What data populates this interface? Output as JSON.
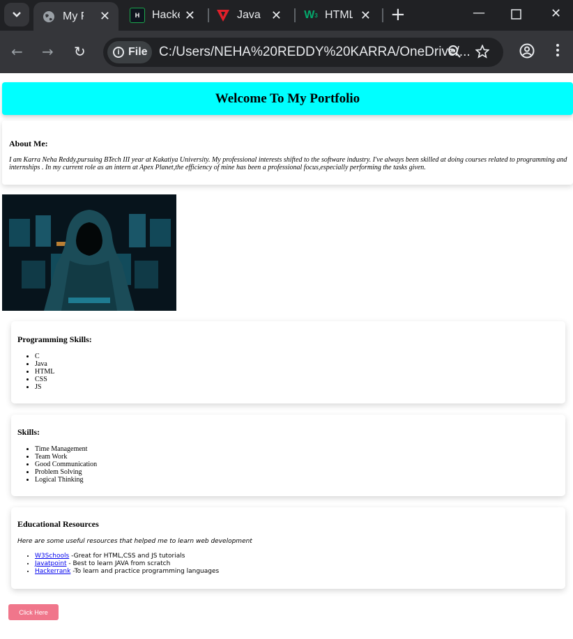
{
  "browser": {
    "tabs": [
      {
        "title": "My First",
        "icon": "globe-icon",
        "active": true
      },
      {
        "title": "HackerRank",
        "icon": "hackerrank-icon",
        "active": false
      },
      {
        "title": "Java Tutorial",
        "icon": "javatpoint-icon",
        "active": false
      },
      {
        "title": "HTML Tutorial",
        "icon": "w3schools-icon",
        "active": false
      }
    ],
    "address": {
      "chip_label": "File",
      "url": "C:/Users/NEHA%20REDDY%20KARRA/OneDrive/..."
    }
  },
  "page": {
    "header_title": "Welcome To My Portfolio",
    "header_color": "#00ffff",
    "about": {
      "heading": "About Me:",
      "text": "I am Karra Neha Reddy,pursuing BTech III year at Kakatiya University. My professional interests shifted to the software industry. I've always been skilled at doing courses related to programming and internships . In my current role as an intern at Apex Planet,the efficiency of mine has been a professional focus,especially performing the tasks given."
    },
    "programming": {
      "heading": "Programming Skills:",
      "items": [
        "C",
        "Java",
        "HTML",
        "CSS",
        "JS"
      ]
    },
    "skills": {
      "heading": "Skills:",
      "items": [
        "Time Management",
        "Team Work",
        "Good Communication",
        "Problem Solving",
        "Logical Thinking"
      ]
    },
    "resources": {
      "heading": "Educational Resources",
      "subtitle": "Here are some useful resources that helped me to learn web development",
      "links": [
        {
          "name": "W3Schools",
          "desc": " -Great for HTML,CSS and JS tutorials"
        },
        {
          "name": "Javatpoint",
          "desc": " - Best to learn JAVA from scratch"
        },
        {
          "name": "Hackerrank",
          "desc": " -To learn and practice programming languages"
        }
      ]
    },
    "button_label": "Click Here",
    "button_color": "#f0768b"
  }
}
